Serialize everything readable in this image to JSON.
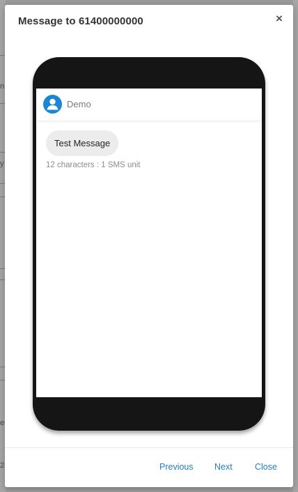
{
  "modal": {
    "title": "Message to 61400000000",
    "close_glyph": "×"
  },
  "background_fragments": {
    "frag_1": "n",
    "frag_2": "y",
    "frag_3": "es",
    "frag_4": "24"
  },
  "chat": {
    "contact_name": "Demo",
    "avatar_icon": "user-icon",
    "message_text": "Test Message",
    "message_meta": "12 characters : 1 SMS unit"
  },
  "footer": {
    "previous_label": "Previous",
    "next_label": "Next",
    "close_label": "Close"
  },
  "colors": {
    "accent": "#1e7fc4",
    "avatar_bg": "#1b86d2",
    "phone_body": "#151515",
    "bubble_bg": "#ececec"
  }
}
